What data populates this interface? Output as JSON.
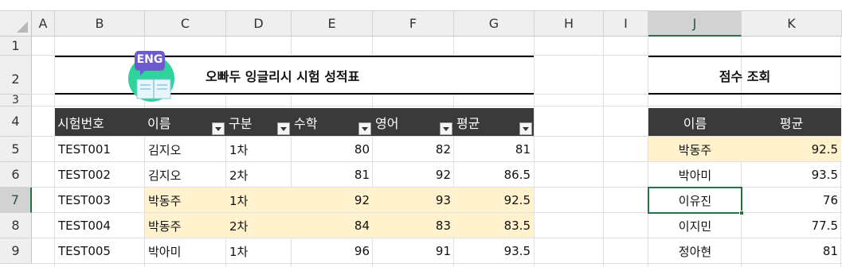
{
  "columns": [
    "A",
    "B",
    "C",
    "D",
    "E",
    "F",
    "G",
    "H",
    "I",
    "J",
    "K"
  ],
  "rows": [
    "1",
    "2",
    "3",
    "4",
    "5",
    "6",
    "7",
    "8",
    "9"
  ],
  "selected_cell": "J7",
  "title": "오빠두 잉글리시 시험 성적표",
  "logo_text": "ENG",
  "lookup_title": "점수 조회",
  "headers": [
    "시험번호",
    "이름",
    "구분",
    "수학",
    "영어",
    "평균"
  ],
  "records": [
    {
      "id": "TEST001",
      "name": "김지오",
      "type": "1차",
      "math": "80",
      "eng": "82",
      "avg": "81"
    },
    {
      "id": "TEST002",
      "name": "김지오",
      "type": "2차",
      "math": "81",
      "eng": "92",
      "avg": "86.5"
    },
    {
      "id": "TEST003",
      "name": "박동주",
      "type": "1차",
      "math": "92",
      "eng": "93",
      "avg": "92.5"
    },
    {
      "id": "TEST004",
      "name": "박동주",
      "type": "2차",
      "math": "84",
      "eng": "83",
      "avg": "83.5"
    },
    {
      "id": "TEST005",
      "name": "박아미",
      "type": "1차",
      "math": "96",
      "eng": "91",
      "avg": "93.5"
    }
  ],
  "lookup_headers": [
    "이름",
    "평균"
  ],
  "lookup": [
    {
      "name": "박동주",
      "avg": "92.5"
    },
    {
      "name": "박아미",
      "avg": "93.5"
    },
    {
      "name": "이유진",
      "avg": "76"
    },
    {
      "name": "이지민",
      "avg": "77.5"
    },
    {
      "name": "정아현",
      "avg": "81"
    }
  ],
  "colors": {
    "header_bar": "#3a3a3a",
    "highlight": "#fff2cc",
    "selection": "#217346",
    "logo_circle": "#2fd39c",
    "logo_tag": "#6e5bd0"
  },
  "icons": [
    "filter-dropdown-icon",
    "eng-book-logo-icon",
    "select-all-icon"
  ]
}
